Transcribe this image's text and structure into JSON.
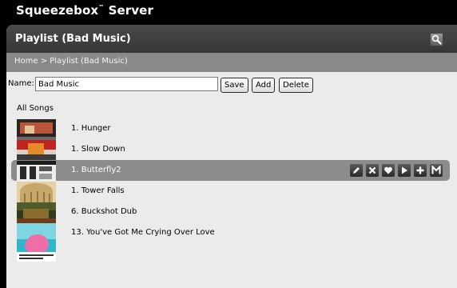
{
  "app": {
    "title_main": "Squeezebox",
    "title_tm": "™",
    "title_rest": " Server"
  },
  "panel": {
    "title": "Playlist (Bad Music)"
  },
  "breadcrumb": {
    "home": "Home",
    "sep": " > ",
    "current": "Playlist (Bad Music)"
  },
  "form": {
    "name_label": "Name:",
    "name_value": "Bad Music",
    "save_label": "Save",
    "add_label": "Add",
    "delete_label": "Delete"
  },
  "section": {
    "label": "All Songs"
  },
  "songs": [
    {
      "label": "1. Hunger"
    },
    {
      "label": "1. Slow Down"
    },
    {
      "label": "1. Butterfly2",
      "selected": true
    },
    {
      "label": "1. Tower Falls"
    },
    {
      "label": "6. Buckshot Dub"
    },
    {
      "label": "13. You've Got Me Crying Over Love"
    }
  ],
  "row_actions": [
    "edit-icon",
    "remove-icon",
    "favorite-icon",
    "play-icon",
    "add-icon",
    "more-icon"
  ],
  "icons": {
    "search": "search-icon"
  },
  "colors": {
    "page_bg": "#000000",
    "panel_bg": "#ebebeb",
    "header_bg": "#3c3c3c",
    "breadcrumb_bg": "#8a8a8a",
    "selected_row": "#8c8c8c"
  }
}
